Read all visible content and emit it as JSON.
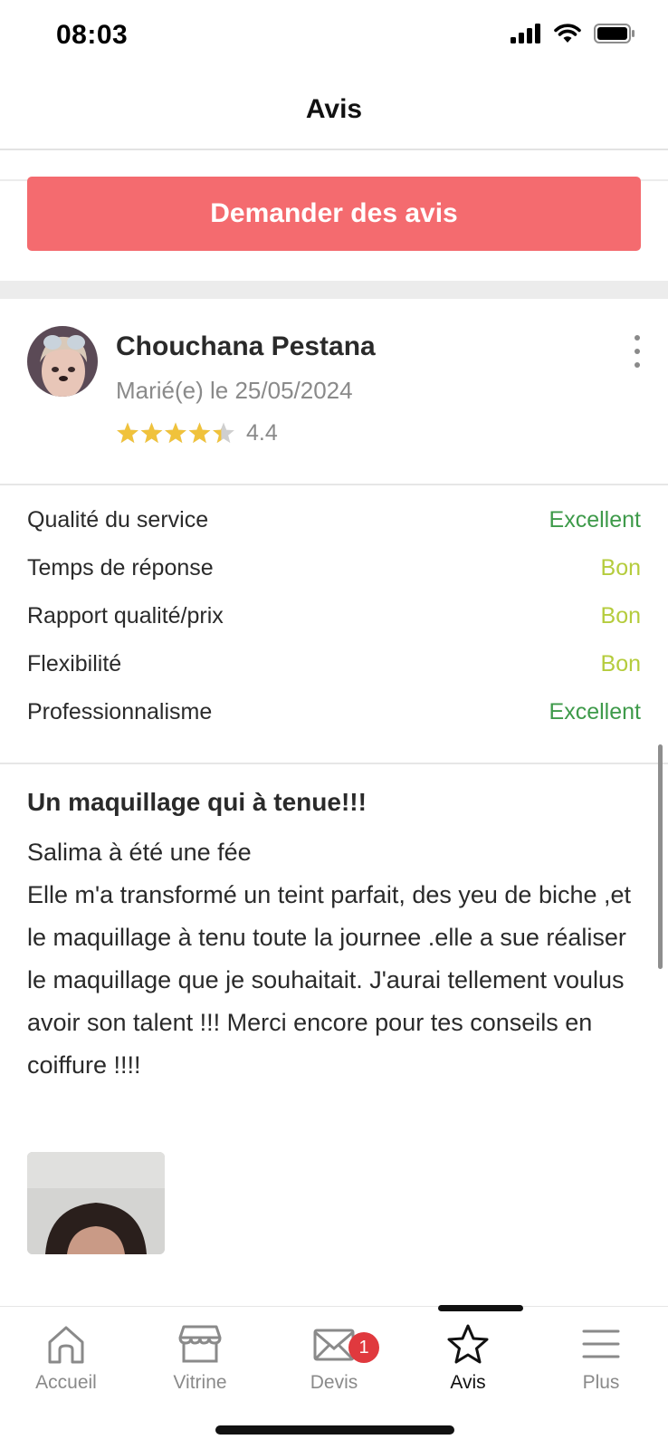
{
  "status_bar": {
    "time": "08:03"
  },
  "header": {
    "title": "Avis"
  },
  "cta": {
    "label": "Demander des avis"
  },
  "review": {
    "reviewer_name": "Chouchana Pestana",
    "married_date": "Marié(e) le 25/05/2024",
    "rating": "4.4",
    "rating_fraction": 0.88,
    "star_color": "#f0c23b",
    "criteria": [
      {
        "label": "Qualité du service",
        "value": "Excellent"
      },
      {
        "label": "Temps de réponse",
        "value": "Bon"
      },
      {
        "label": "Rapport qualité/prix",
        "value": "Bon"
      },
      {
        "label": "Flexibilité",
        "value": "Bon"
      },
      {
        "label": "Professionnalisme",
        "value": "Excellent"
      }
    ],
    "title": "Un maquillage qui à tenue!!!",
    "body": "Salima à été une fée\nElle m'a transformé un teint parfait, des yeu de biche ,et le maquillage à tenu toute la journee .elle a sue réaliser le maquillage que je souhaitait. J'aurai tellement voulus avoir son talent !!! Merci encore pour tes conseils en coiffure !!!!"
  },
  "colors": {
    "accent": "#f46b6f",
    "excellent": "#3e9a4a",
    "good": "#b5cc3d",
    "badge": "#e0393e"
  },
  "tabs": [
    {
      "label": "Accueil",
      "icon": "home-icon"
    },
    {
      "label": "Vitrine",
      "icon": "storefront-icon"
    },
    {
      "label": "Devis",
      "icon": "mail-icon",
      "badge": "1"
    },
    {
      "label": "Avis",
      "icon": "star-icon",
      "active": true
    },
    {
      "label": "Plus",
      "icon": "menu-icon"
    }
  ]
}
